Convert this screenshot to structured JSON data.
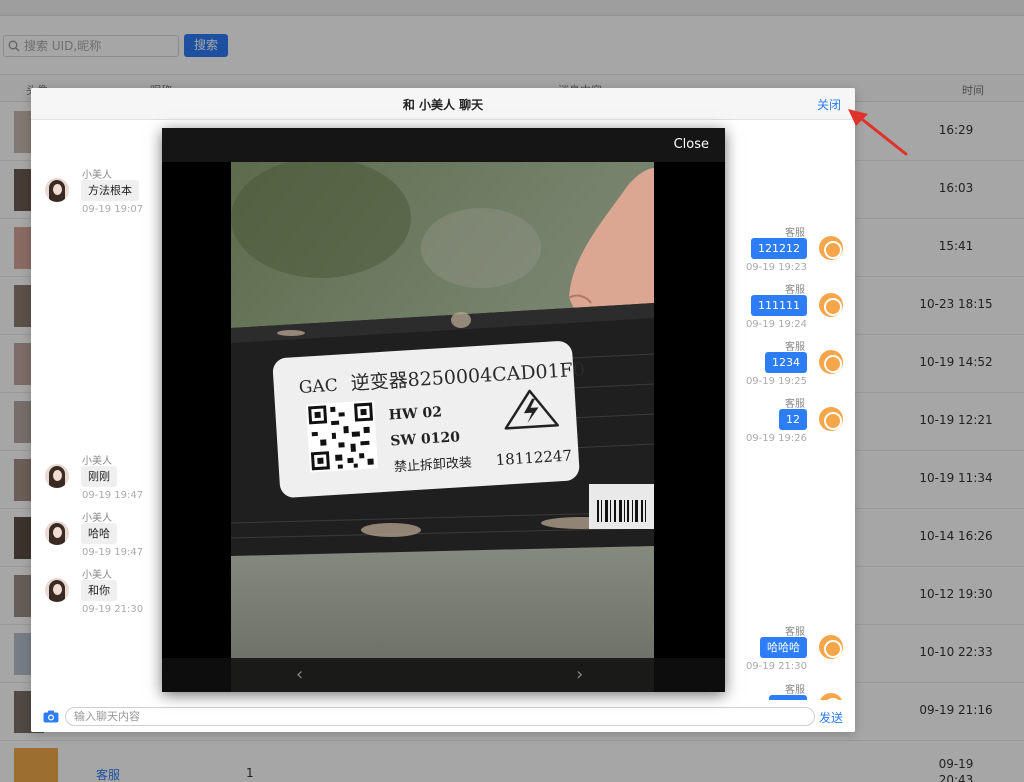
{
  "search": {
    "placeholder": "搜索 UID,昵称",
    "button_label": "搜索"
  },
  "table": {
    "headers": [
      "头像",
      "昵称",
      "消息内容",
      "时间"
    ],
    "rows": [
      {
        "time": "16:29"
      },
      {
        "time": "16:03"
      },
      {
        "time": "15:41"
      },
      {
        "time": "10-23 18:15"
      },
      {
        "time": "10-19 14:52"
      },
      {
        "time": "10-19 12:21"
      },
      {
        "time": "10-19 11:34"
      },
      {
        "time": "10-14 16:26"
      },
      {
        "time": "10-12 19:30"
      },
      {
        "time": "10-10 22:33"
      },
      {
        "time": "09-19 21:16"
      }
    ],
    "last_row": {
      "nickname": "客服",
      "count": "1",
      "time_line1": "09-19",
      "time_line2": "20:43"
    }
  },
  "chat": {
    "title": "和 小美人 聊天",
    "close_label": "关闭",
    "input_placeholder": "输入聊天内容",
    "send_label": "发送",
    "messages": [
      {
        "side": "left",
        "name": "小美人",
        "text": "方法根本",
        "time": "09-19 19:07"
      },
      {
        "side": "right",
        "name": "客服",
        "text": "121212",
        "time": "09-19 19:23"
      },
      {
        "side": "right",
        "name": "客服",
        "text": "111111",
        "time": "09-19 19:24"
      },
      {
        "side": "right",
        "name": "客服",
        "text": "1234",
        "time": "09-19 19:25"
      },
      {
        "side": "right",
        "name": "客服",
        "text": "12",
        "time": "09-19 19:26"
      },
      {
        "side": "left",
        "name": "小美人",
        "text": "刚刚",
        "time": "09-19 19:47"
      },
      {
        "side": "left",
        "name": "小美人",
        "text": "哈哈",
        "time": "09-19 19:47"
      },
      {
        "side": "left",
        "name": "小美人",
        "text": "和你",
        "time": "09-19 21:30"
      },
      {
        "side": "right",
        "name": "客服",
        "text": "哈哈哈",
        "time": "09-19 21:30"
      },
      {
        "side": "right",
        "name": "客服",
        "text": "",
        "time": ""
      }
    ]
  },
  "viewer": {
    "close_label": "Close",
    "prev_label": "‹",
    "next_label": "›",
    "photo_label": {
      "brand": "GAC",
      "part": "逆变器8250004CAD01F0",
      "hw": "HW 02",
      "sw": "SW 0120",
      "warning": "禁止拆卸改装",
      "serial": "18112247"
    }
  },
  "colors": {
    "accent": "#2d7df6",
    "cs_avatar": "#f5a64b",
    "arrow": "#e0312b"
  }
}
